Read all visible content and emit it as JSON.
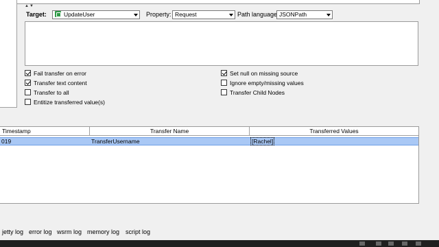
{
  "target_row": {
    "target_label": "Target:",
    "target_value": "UpdateUser",
    "property_label": "Property:",
    "property_value": "Request",
    "path_language_label": "Path language:",
    "path_language_value": "JSONPath"
  },
  "options_left": [
    {
      "label": "Fail transfer on error",
      "checked": true
    },
    {
      "label": "Transfer text content",
      "checked": true
    },
    {
      "label": "Transfer to all",
      "checked": false
    },
    {
      "label": "Entitize transferred value(s)",
      "checked": false
    }
  ],
  "options_right": [
    {
      "label": "Set null on missing source",
      "checked": true
    },
    {
      "label": "Ignore empty/missing values",
      "checked": false
    },
    {
      "label": "Transfer Child Nodes",
      "checked": false
    }
  ],
  "table": {
    "columns": [
      "Timestamp",
      "Transfer Name",
      "Transferred Values"
    ],
    "rows": [
      {
        "timestamp": "019",
        "transfer_name": "TransferUsername",
        "values": "[Rachel]"
      }
    ]
  },
  "log_tabs": [
    "jetty log",
    "error log",
    "wsrm log",
    "memory log",
    "script log"
  ]
}
